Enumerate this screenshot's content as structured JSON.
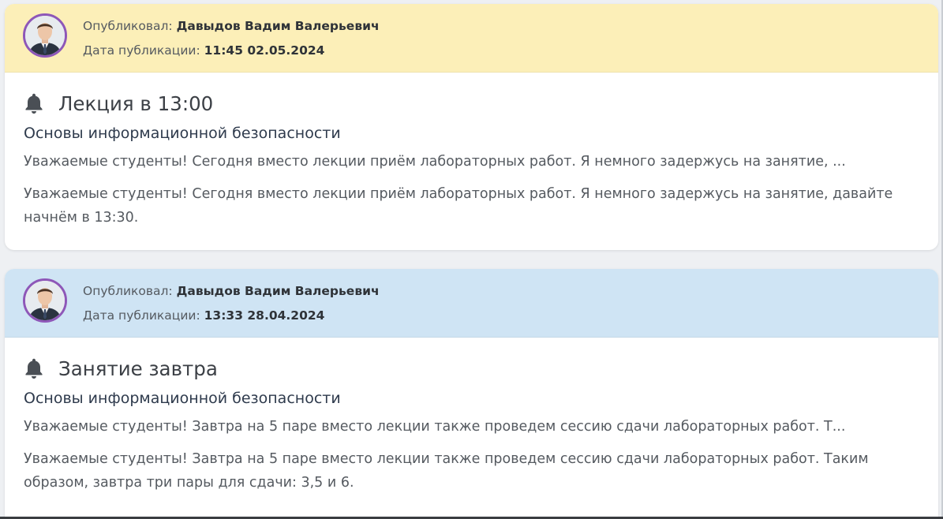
{
  "labels": {
    "published_by": "Опубликовал:",
    "published_at": "Дата публикации:"
  },
  "colors": {
    "header_yellow": "#fcefb8",
    "header_blue": "#cfe4f4",
    "avatar_ring": "#8e57b8",
    "page_bg": "#eef0f3"
  },
  "icons": {
    "notification": "bell-icon"
  },
  "posts": [
    {
      "header_color": "#fcefb8",
      "author": "Давыдов Вадим Валерьевич",
      "date": "11:45 02.05.2024",
      "title": "Лекция в 13:00",
      "subject": "Основы информационной безопасности",
      "preview": "Уважаемые студенты! Сегодня вместо лекции приём лабораторных работ. Я немного задержусь на занятие, ...",
      "text": "Уважаемые студенты! Сегодня вместо лекции приём лабораторных работ. Я немного задержусь на занятие, давайте начнём в 13:30."
    },
    {
      "header_color": "#cfe4f4",
      "author": "Давыдов Вадим Валерьевич",
      "date": "13:33 28.04.2024",
      "title": "Занятие завтра",
      "subject": "Основы информационной безопасности",
      "preview": "Уважаемые студенты! Завтра на 5 паре вместо лекции также проведем сессию сдачи лабораторных работ. Т...",
      "text": "Уважаемые студенты! Завтра на 5 паре вместо лекции также проведем сессию сдачи лабораторных работ. Таким образом, завтра три пары для сдачи: 3,5 и 6."
    }
  ]
}
